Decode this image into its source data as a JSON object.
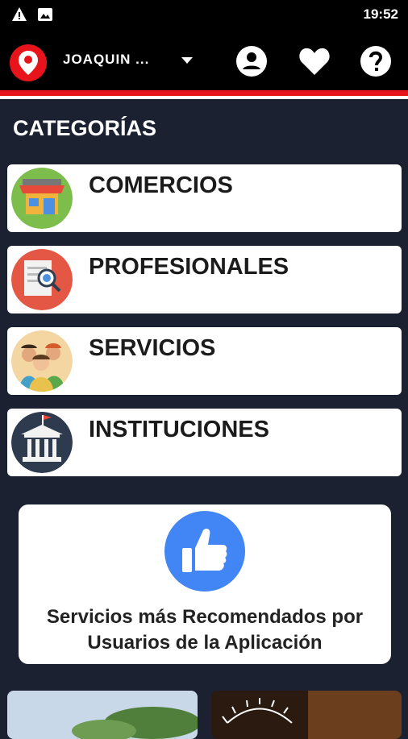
{
  "status": {
    "time": "19:52"
  },
  "header": {
    "location": "JOAQUIN ..."
  },
  "section": {
    "title": "CATEGORÍAS"
  },
  "categories": [
    {
      "label": "COMERCIOS",
      "icon": "store-icon"
    },
    {
      "label": "PROFESIONALES",
      "icon": "document-magnifier-icon"
    },
    {
      "label": "SERVICIOS",
      "icon": "people-icon"
    },
    {
      "label": "INSTITUCIONES",
      "icon": "building-icon"
    }
  ],
  "recommend": {
    "line1": "Servicios más Recomendados por",
    "line2": "Usuarios de la Aplicación"
  },
  "colors": {
    "accent": "#e8141c",
    "background": "#1b2131",
    "thumbs": "#4285f4"
  }
}
